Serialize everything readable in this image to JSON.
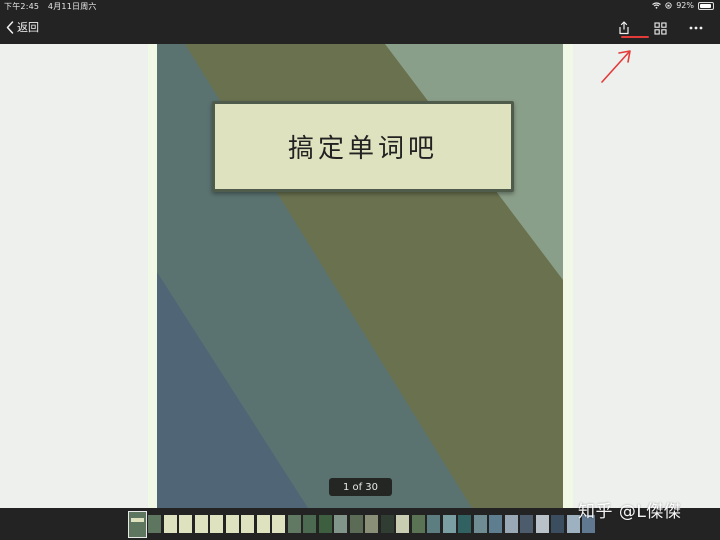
{
  "status_bar": {
    "time": "下午2:45",
    "date": "4月11日周六",
    "battery": "92%",
    "battery_level": 0.92
  },
  "nav": {
    "back_label": "返回",
    "share_icon": "share-icon",
    "grid_icon": "grid-icon",
    "more_icon": "more-icon",
    "annotation_color": "#e33a3a"
  },
  "document": {
    "title": "搞定单词吧",
    "page_indicator": "1 of 30",
    "colors": {
      "light_green": "#8a9f89",
      "olive": "#6a714f",
      "teal": "#5a7370",
      "slate_blue": "#506676",
      "card": "#dfe2bf"
    }
  },
  "thumbnails": {
    "count": 30,
    "current": 1,
    "colors": [
      "#5e7560",
      "#5e7560",
      "#dfe2bf",
      "#dfe2bf",
      "#dfe2bf",
      "#dfe2bf",
      "#dfe2bf",
      "#dfe2bf",
      "#dfe2bf",
      "#dfe2bf",
      "#617862",
      "#4c6a52",
      "#3d5e3f",
      "#82958a",
      "#5c6b55",
      "#8a8f78",
      "#2f3d33",
      "#c8ccb0",
      "#5a7355",
      "#5c7e80",
      "#7a9fa2",
      "#316261",
      "#6f8c93",
      "#5e7e90",
      "#9aa8b6",
      "#4c5c6c",
      "#b8c2c8",
      "#3b4e60",
      "#9db1c0",
      "#607890"
    ]
  },
  "watermark": "知乎 @L傑傑"
}
